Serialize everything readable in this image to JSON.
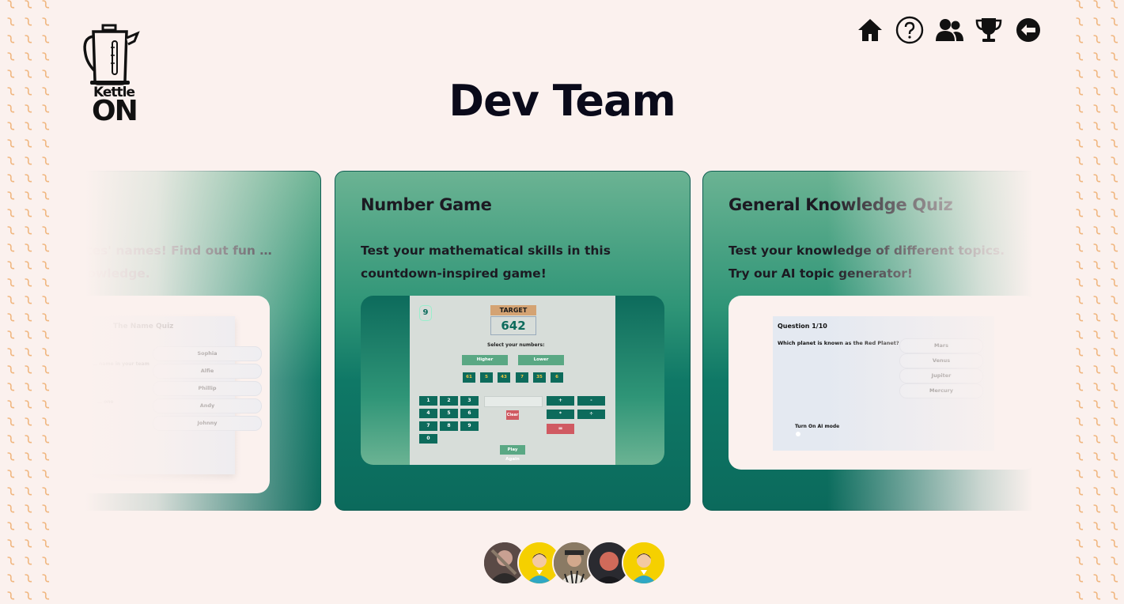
{
  "app": {
    "logo_line1": "Kettle",
    "logo_line2": "ON",
    "page_title": "Dev Team"
  },
  "nav": [
    {
      "icon": "home-icon"
    },
    {
      "icon": "help-icon"
    },
    {
      "icon": "team-icon"
    },
    {
      "icon": "trophy-icon"
    },
    {
      "icon": "logout-icon"
    }
  ],
  "colors": {
    "background": "#fbf1ee",
    "card_gradient_top": "#6bb393",
    "card_gradient_bottom": "#0b6a5c",
    "accent_yellow": "#f5d000"
  },
  "cards": {
    "left": {
      "title": "",
      "description": "… teammates' names! Find out fun … general knowledge.",
      "preview": {
        "title": "The Name Quiz",
        "prompt": "… name in your team",
        "side_text": "… one",
        "options": [
          "Sophia",
          "Alfie",
          "Phillip",
          "Andy",
          "Johnny"
        ]
      }
    },
    "center": {
      "title": "Number Game",
      "description": "Test your mathematical skills in this countdown-inspired game!",
      "preview": {
        "round": "9",
        "target_label": "TARGET",
        "target_value": "642",
        "select_label": "Select your numbers:",
        "higher": "Higher",
        "lower": "Lower",
        "numbers": [
          "61",
          "5",
          "43",
          "7",
          "35",
          "6"
        ],
        "keys": [
          "1",
          "2",
          "3",
          "4",
          "5",
          "6",
          "7",
          "8",
          "9",
          "0"
        ],
        "ops": [
          "+",
          "-",
          "*",
          "÷"
        ],
        "equals": "=",
        "clear": "Clear",
        "play_again": "Play Again"
      }
    },
    "right": {
      "title": "General Knowledge Quiz",
      "description": "Test your knowledge of different topics. Try our AI topic generator!",
      "preview": {
        "question_num": "Question 1/10",
        "question": "Which planet is known as the Red Planet?",
        "options": [
          "Mars",
          "Venus",
          "Jupiter",
          "Mercury"
        ],
        "ai_toggle": "Turn On AI mode"
      }
    }
  },
  "team": [
    {
      "name": "member-1",
      "type": "photo"
    },
    {
      "name": "member-2",
      "type": "illustration"
    },
    {
      "name": "member-3",
      "type": "photo"
    },
    {
      "name": "member-4",
      "type": "photo"
    },
    {
      "name": "member-5",
      "type": "illustration"
    }
  ]
}
